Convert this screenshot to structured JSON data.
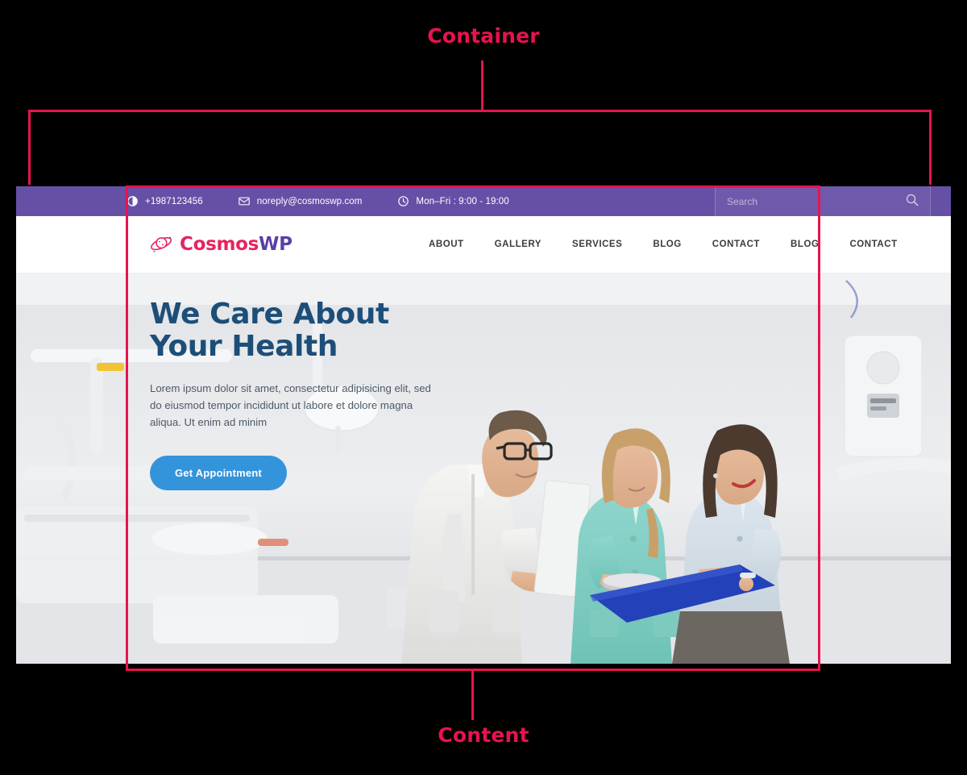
{
  "annotations": {
    "container_label": "Container",
    "content_label": "Content",
    "line_color": "#e8134f"
  },
  "site": {
    "topbar": {
      "bg_color": "#6650a6",
      "items": [
        {
          "icon": "phone-icon",
          "text": "+1987123456"
        },
        {
          "icon": "envelope-icon",
          "text": "noreply@cosmoswp.com"
        },
        {
          "icon": "clock-icon",
          "text": "Mon–Fri : 9:00 - 19:00"
        }
      ],
      "search": {
        "placeholder": "Search",
        "value": "",
        "icon": "search-icon"
      }
    },
    "header": {
      "logo": {
        "icon": "planet-icon",
        "text_primary": "Cosmos",
        "text_secondary": "WP",
        "primary_color": "#e8225f",
        "secondary_color": "#5b3fa8"
      },
      "nav": [
        {
          "label": "ABOUT"
        },
        {
          "label": "GALLERY"
        },
        {
          "label": "SERVICES"
        },
        {
          "label": "BLOG"
        },
        {
          "label": "CONTACT"
        },
        {
          "label": "BLOG"
        },
        {
          "label": "CONTACT"
        }
      ]
    },
    "hero": {
      "title_line1": "We Care About",
      "title_line2": "Your Health",
      "title_color": "#1d4e79",
      "subtitle": "Lorem ipsum dolor sit amet, consectetur adipisicing elit, sed do eiusmod tempor incididunt ut labore et dolore magna aliqua. Ut enim ad minim",
      "button_label": "Get Appointment",
      "button_color": "#3494db"
    }
  }
}
